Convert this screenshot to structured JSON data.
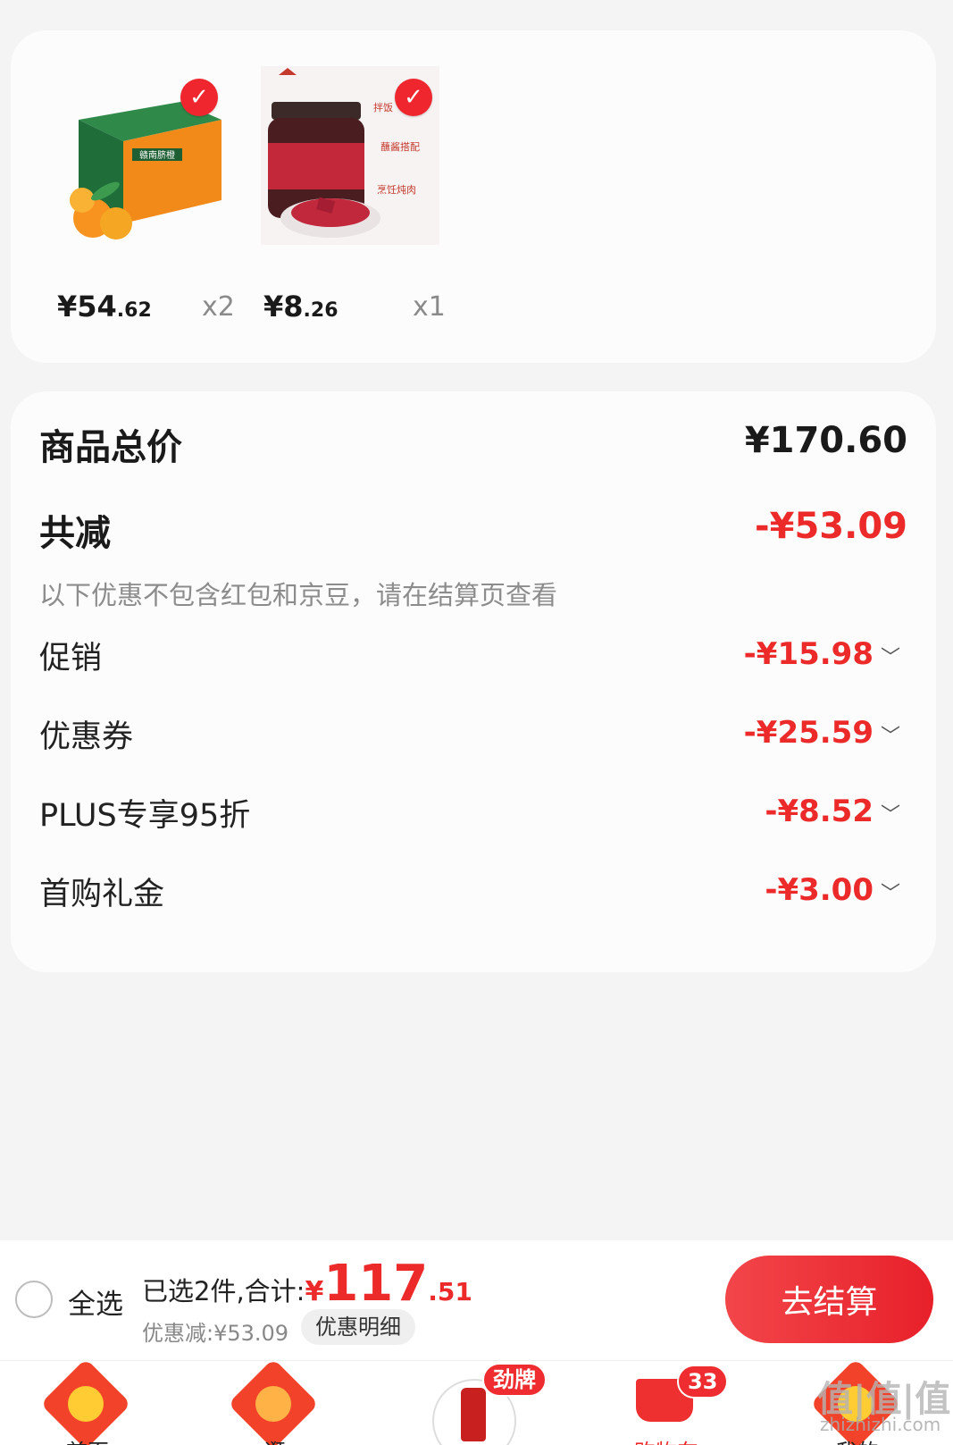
{
  "products": [
    {
      "price_int": "¥54",
      "price_dec": ".62",
      "qty": "x2",
      "image": "orange-box",
      "checked": true
    },
    {
      "price_int": "¥8",
      "price_dec": ".26",
      "qty": "x1",
      "image": "sauce-jar",
      "checked": true
    }
  ],
  "product_images": {
    "orange-box": {
      "box_text": "赣南脐橙"
    },
    "sauce-jar": {
      "tag1": "拌饭",
      "tag2": "蘸酱搭配",
      "tag3": "烹饪炖肉"
    }
  },
  "summary": {
    "total_label": "商品总价",
    "total_value": "¥170.60",
    "reduce_label": "共减",
    "reduce_value": "-¥53.09",
    "note": "以下优惠不包含红包和京豆，请在结算页查看",
    "details": [
      {
        "label": "促销",
        "value": "-¥15.98"
      },
      {
        "label": "优惠券",
        "value": "-¥25.59"
      },
      {
        "label": "PLUS专享95折",
        "value": "-¥8.52"
      },
      {
        "label": "首购礼金",
        "value": "-¥3.00"
      }
    ]
  },
  "bottom_bar": {
    "select_all": "全选",
    "selected_text": "已选2件,合计:",
    "currency": "¥",
    "total_int": "117",
    "total_dec": ".51",
    "discount_text": "优惠减:¥53.09",
    "detail_button": "优惠明细",
    "checkout_button": "去结算"
  },
  "tabbar": {
    "tabs": [
      {
        "label": "首页",
        "icon": "home-icon"
      },
      {
        "label": "逛",
        "icon": "explore-icon"
      },
      {
        "label": "劲牌",
        "icon": "brand-promo-icon"
      },
      {
        "label": "购物车",
        "icon": "cart-icon",
        "badge": "33"
      },
      {
        "label": "我的",
        "icon": "profile-icon"
      }
    ],
    "promo_badge": "劲牌",
    "cart_badge": "33"
  },
  "watermark": {
    "main": "值|值|值",
    "sub": "zhizhizhi.com"
  },
  "colors": {
    "accent": "#ec2a2a",
    "check": "#f0262f",
    "background": "#f4f4f4"
  }
}
